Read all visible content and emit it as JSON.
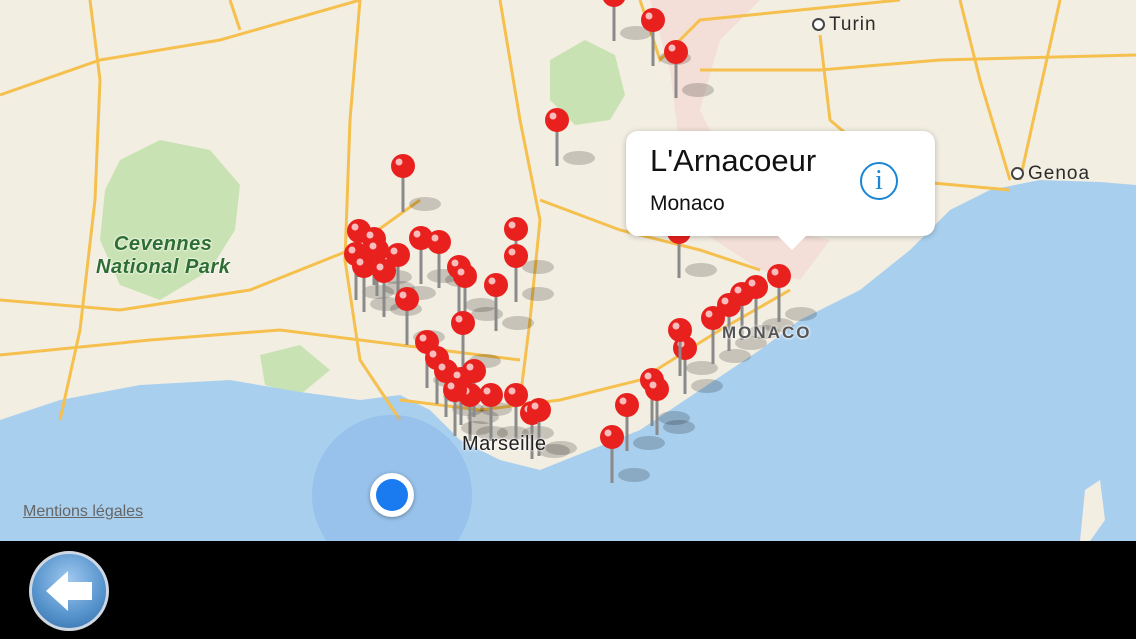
{
  "map": {
    "cities": [
      "Turin",
      "Genoa"
    ],
    "park": [
      "Cevennes",
      "National Park"
    ],
    "region_label": "MONACO",
    "coastal_city": "Marseille",
    "legal_link": "Mentions légales",
    "pin_count": 52
  },
  "callout": {
    "title": "L'Arnacoeur",
    "subtitle": "Monaco",
    "info_icon": "i"
  },
  "toolbar": {
    "back_icon": "arrow-left-icon"
  },
  "colors": {
    "pin": "#e8211f",
    "water": "#a9cfee",
    "road": "#f5c04e",
    "accent": "#1a86d6"
  }
}
